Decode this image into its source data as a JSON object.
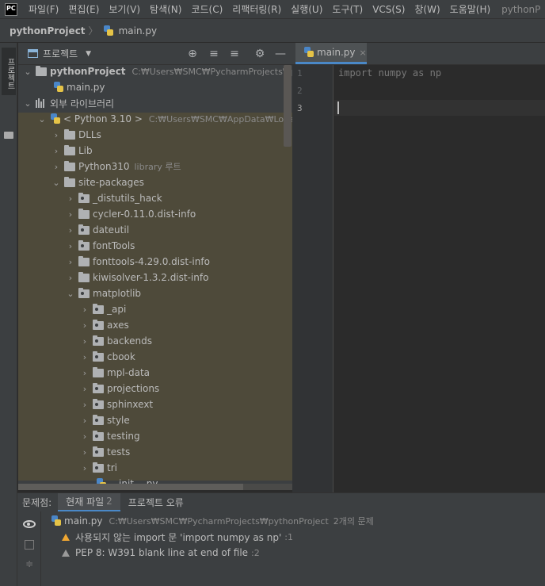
{
  "app": {
    "logo_text": "PC",
    "window_title": "pythonP"
  },
  "menu": [
    "파일(F)",
    "편집(E)",
    "보기(V)",
    "탐색(N)",
    "코드(C)",
    "리팩터링(R)",
    "실행(U)",
    "도구(T)",
    "VCS(S)",
    "창(W)",
    "도움말(H)"
  ],
  "breadcrumb": {
    "project": "pythonProject",
    "separator": "〉",
    "file": "main.py"
  },
  "left_stripe": {
    "project_tab": "프로젝트"
  },
  "project_panel": {
    "title": "프로젝트",
    "caret": "▼",
    "tools": {
      "locate": "⊕",
      "expand_all": "≡",
      "collapse_all": "≡",
      "settings": "⚙",
      "hide": "—"
    }
  },
  "tree": {
    "project_root": {
      "label": "pythonProject",
      "path": "C:₩Users₩SMC₩PycharmProjects₩pytho"
    },
    "main_file": "main.py",
    "external_libs": "외부 라이브러리",
    "python_sdk": {
      "label": "< Python 3.10 >",
      "path": "C:₩Users₩SMC₩AppData₩Local₩Pr"
    },
    "dlls": "DLLs",
    "lib": "Lib",
    "python310": {
      "label": "Python310",
      "hint": "library 루트"
    },
    "site_packages": "site-packages",
    "sp_items": [
      "_distutils_hack",
      "cycler-0.11.0.dist-info",
      "dateutil",
      "fontTools",
      "fonttools-4.29.0.dist-info",
      "kiwisolver-1.3.2.dist-info"
    ],
    "matplotlib": "matplotlib",
    "mpl_items": [
      "_api",
      "axes",
      "backends",
      "cbook",
      "mpl-data",
      "projections",
      "sphinxext",
      "style",
      "testing",
      "tests",
      "tri"
    ],
    "init_file": "__init__.py"
  },
  "editor": {
    "tab_label": "main.py",
    "tab_close": "×",
    "line_numbers": [
      "1",
      "2",
      "3"
    ],
    "code_lines": [
      "import numpy as np",
      "",
      ""
    ]
  },
  "problems": {
    "label": "문제점:",
    "tab_current": "현재 파일",
    "tab_current_count": "2",
    "tab_project": "프로젝트 오류",
    "file": "main.py",
    "file_path": "C:₩Users₩SMC₩PycharmProjects₩pythonProject",
    "summary": "2개의 문제",
    "warnings": [
      {
        "text": "사용되지 않는 import 문 'import numpy as np'",
        "line": ":1"
      },
      {
        "text": "PEP 8: W391 blank line at end of file",
        "line": ":2"
      }
    ]
  },
  "colors": {
    "accent": "#4a88c7",
    "warning": "#f0a732",
    "tree_highlight": "#4e4a3a"
  }
}
